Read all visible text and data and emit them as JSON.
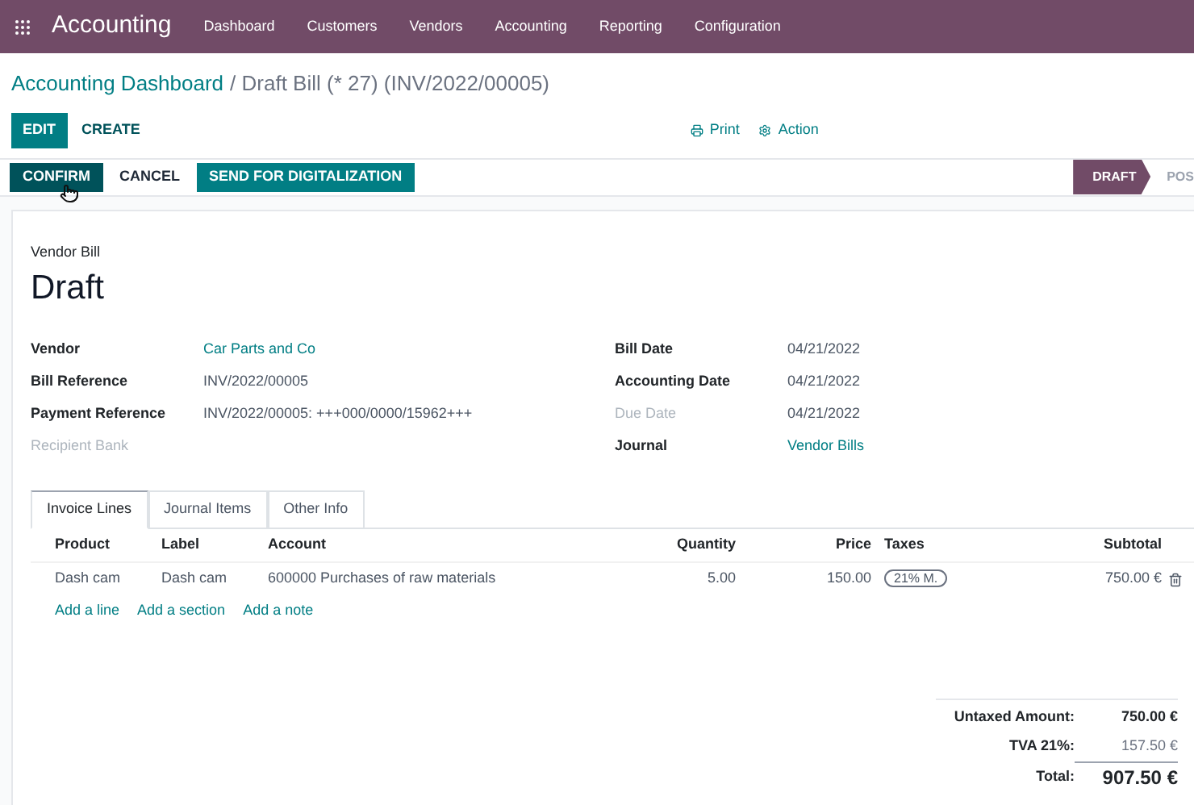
{
  "navbar": {
    "app": "Accounting",
    "menu": [
      "Dashboard",
      "Customers",
      "Vendors",
      "Accounting",
      "Reporting",
      "Configuration"
    ]
  },
  "breadcrumb": {
    "parent": "Accounting Dashboard",
    "current": "/ Draft Bill (* 27) (INV/2022/00005)"
  },
  "toolbar": {
    "primary": "EDIT",
    "secondary": "CREATE",
    "print": "Print",
    "action": "Action"
  },
  "statusbar": {
    "buttons": [
      {
        "label": "CONFIRM",
        "kind": "dark"
      },
      {
        "label": "CANCEL",
        "kind": "plain"
      },
      {
        "label": "SEND FOR DIGITALIZATION",
        "kind": "teal"
      }
    ],
    "stages": [
      {
        "label": "DRAFT",
        "selected": true
      },
      {
        "label": "POS",
        "selected": false
      }
    ]
  },
  "sheet": {
    "subtitle": "Vendor Bill",
    "title": "Draft",
    "left_fields": [
      {
        "label": "Vendor",
        "value": "Car Parts and Co",
        "kind": "link",
        "disabled": false
      },
      {
        "label": "Bill Reference",
        "value": "INV/2022/00005",
        "kind": "text",
        "disabled": false
      },
      {
        "label": "Payment Reference",
        "value": "INV/2022/00005: +++000/0000/15962+++",
        "kind": "text",
        "disabled": false
      },
      {
        "label": "Recipient Bank",
        "disabled": true
      }
    ],
    "right_fields": [
      {
        "label": "Bill Date",
        "value": "04/21/2022",
        "kind": "text",
        "disabled": false
      },
      {
        "label": "Accounting Date",
        "value": "04/21/2022",
        "kind": "text",
        "disabled": false
      },
      {
        "label": "Due Date",
        "value": "04/21/2022",
        "kind": "text",
        "disabled": true
      },
      {
        "label": "Journal",
        "value": "Vendor Bills",
        "kind": "link",
        "disabled": false
      }
    ],
    "tabs": [
      {
        "label": "Invoice Lines",
        "selected": true
      },
      {
        "label": "Journal Items",
        "selected": false
      },
      {
        "label": "Other Info",
        "selected": false
      }
    ],
    "columns": [
      "Product",
      "Label",
      "Account",
      "Quantity",
      "Price",
      "Taxes",
      "Subtotal"
    ],
    "rows": [
      {
        "product": "Dash cam",
        "label": "Dash cam",
        "account": "600000 Purchases of raw materials",
        "quantity": "5.00",
        "price": "150.00",
        "tax": "21% M.",
        "subtotal": "750.00 €"
      }
    ],
    "add_links": [
      "Add a line",
      "Add a section",
      "Add a note"
    ],
    "totals": [
      {
        "label": "Untaxed Amount:",
        "value": "750.00 €",
        "kind": "normal"
      },
      {
        "label": "TVA 21%:",
        "value": "157.50 €",
        "kind": "tax"
      },
      {
        "label": "Total:",
        "value": "907.50 €",
        "kind": "grand"
      }
    ]
  }
}
